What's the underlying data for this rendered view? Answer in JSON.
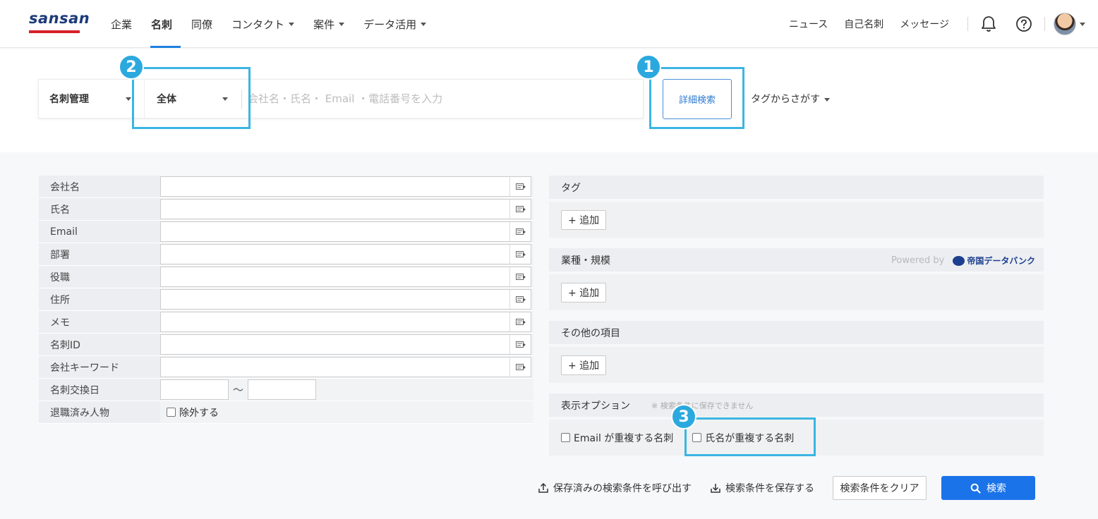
{
  "header": {
    "logo": "sansan",
    "nav": [
      {
        "label": "企業",
        "dropdown": false
      },
      {
        "label": "名刺",
        "dropdown": false,
        "active": true
      },
      {
        "label": "同僚",
        "dropdown": false
      },
      {
        "label": "コンタクト",
        "dropdown": true
      },
      {
        "label": "案件",
        "dropdown": true
      },
      {
        "label": "データ活用",
        "dropdown": true
      }
    ],
    "right_links": [
      "ニュース",
      "自己名刺",
      "メッセージ"
    ],
    "icons": [
      "bell-icon",
      "help-icon",
      "avatar"
    ]
  },
  "search": {
    "scope_primary": "名刺管理",
    "scope_secondary": "全体",
    "placeholder": "会社名・氏名・ Email ・電話番号を入力",
    "detail_button": "詳細検索",
    "tag_search": "タグからさがす"
  },
  "annotations": {
    "badge1": "1",
    "badge2": "2",
    "badge3": "3"
  },
  "form": {
    "fields": [
      "会社名",
      "氏名",
      "Email",
      "部署",
      "役職",
      "住所",
      "メモ",
      "名刺ID",
      "会社キーワード"
    ],
    "date_label": "名刺交換日",
    "date_separator": "〜",
    "retired_label": "退職済み人物",
    "retired_checkbox": "除外する"
  },
  "right_panel": {
    "tag_title": "タグ",
    "industry_title": "業種・規模",
    "powered_by": "Powered by",
    "provider": "帝国データバンク",
    "other_title": "その他の項目",
    "add_label": "+ 追加",
    "display_title": "表示オプション",
    "display_note": "※ 検索条件に保存できません",
    "option_email": "Email が重複する名刺",
    "option_name": "氏名が重複する名刺"
  },
  "actions": {
    "load": "保存済みの検索条件を呼び出す",
    "save": "検索条件を保存する",
    "clear": "検索条件をクリア",
    "search": "検索"
  },
  "colors": {
    "accent": "#1a73e8",
    "highlight": "#3bb5e3",
    "logo_red": "#d6202a",
    "logo_navy": "#1d3a7a"
  }
}
